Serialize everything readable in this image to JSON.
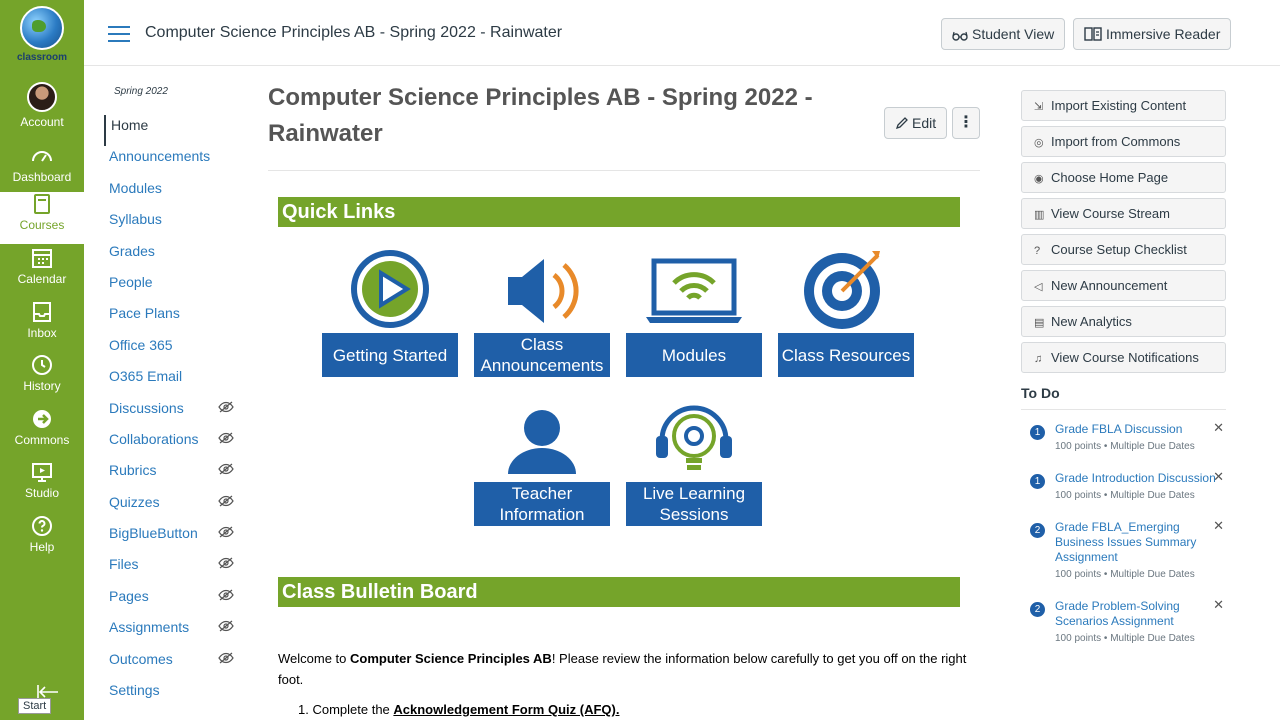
{
  "gnav": {
    "logo_caption": "classroom",
    "items": [
      {
        "label": "Account"
      },
      {
        "label": "Dashboard"
      },
      {
        "label": "Courses"
      },
      {
        "label": "Calendar"
      },
      {
        "label": "Inbox"
      },
      {
        "label": "History"
      },
      {
        "label": "Commons"
      },
      {
        "label": "Studio"
      },
      {
        "label": "Help"
      }
    ],
    "start_label": "Start"
  },
  "header": {
    "breadcrumb": "Computer Science Principles AB - Spring 2022 - Rainwater",
    "student_view": "Student View",
    "immersive_reader": "Immersive Reader"
  },
  "course_nav": {
    "term": "Spring 2022",
    "items": [
      {
        "label": "Home"
      },
      {
        "label": "Announcements"
      },
      {
        "label": "Modules"
      },
      {
        "label": "Syllabus"
      },
      {
        "label": "Grades"
      },
      {
        "label": "People"
      },
      {
        "label": "Pace Plans"
      },
      {
        "label": "Office 365"
      },
      {
        "label": "O365 Email"
      },
      {
        "label": "Discussions"
      },
      {
        "label": "Collaborations"
      },
      {
        "label": "Rubrics"
      },
      {
        "label": "Quizzes"
      },
      {
        "label": "BigBlueButton"
      },
      {
        "label": "Files"
      },
      {
        "label": "Pages"
      },
      {
        "label": "Assignments"
      },
      {
        "label": "Outcomes"
      },
      {
        "label": "Settings"
      }
    ]
  },
  "main": {
    "title": "Computer Science Principles AB - Spring 2022 - Rainwater",
    "edit_label": "Edit",
    "quick_links_heading": "Quick  Links",
    "tiles": [
      {
        "label": "Getting Started"
      },
      {
        "label": "Class Announcements"
      },
      {
        "label": "Modules"
      },
      {
        "label": "Class Resources"
      },
      {
        "label": "Teacher Information"
      },
      {
        "label": "Live Learning Sessions"
      }
    ],
    "bulletin_heading": "Class Bulletin Board",
    "welcome_pre": "Welcome to ",
    "welcome_course": "Computer Science Principles AB",
    "welcome_post": "! Please review the information below carefully to get you off on the right foot.",
    "step1_pre": "1. Complete the ",
    "step1_bold": "Acknowledgement Form Quiz (AFQ)."
  },
  "sidebar": {
    "buttons": [
      {
        "label": "Import Existing Content",
        "icon": "import-icon"
      },
      {
        "label": "Import from Commons",
        "icon": "commons-icon"
      },
      {
        "label": "Choose Home Page",
        "icon": "target-icon"
      },
      {
        "label": "View Course Stream",
        "icon": "stream-icon"
      },
      {
        "label": "Course Setup Checklist",
        "icon": "question-icon"
      },
      {
        "label": "New Announcement",
        "icon": "megaphone-icon"
      },
      {
        "label": "New Analytics",
        "icon": "analytics-icon"
      },
      {
        "label": "View Course Notifications",
        "icon": "bell-icon"
      }
    ],
    "todo_heading": "To Do",
    "todos": [
      {
        "count": "1",
        "title": "Grade FBLA Discussion",
        "meta": "100 points • Multiple Due Dates"
      },
      {
        "count": "1",
        "title": "Grade Introduction Discussion",
        "meta": "100 points • Multiple Due Dates"
      },
      {
        "count": "2",
        "title": "Grade FBLA_Emerging Business Issues Summary Assignment",
        "meta": "100 points • Multiple Due Dates"
      },
      {
        "count": "2",
        "title": "Grade Problem-Solving Scenarios Assignment",
        "meta": "100 points • Multiple Due Dates"
      }
    ]
  },
  "colors": {
    "brand_green": "#75a42a",
    "link_blue": "#2b7abc",
    "tile_blue": "#1f5fa8"
  }
}
